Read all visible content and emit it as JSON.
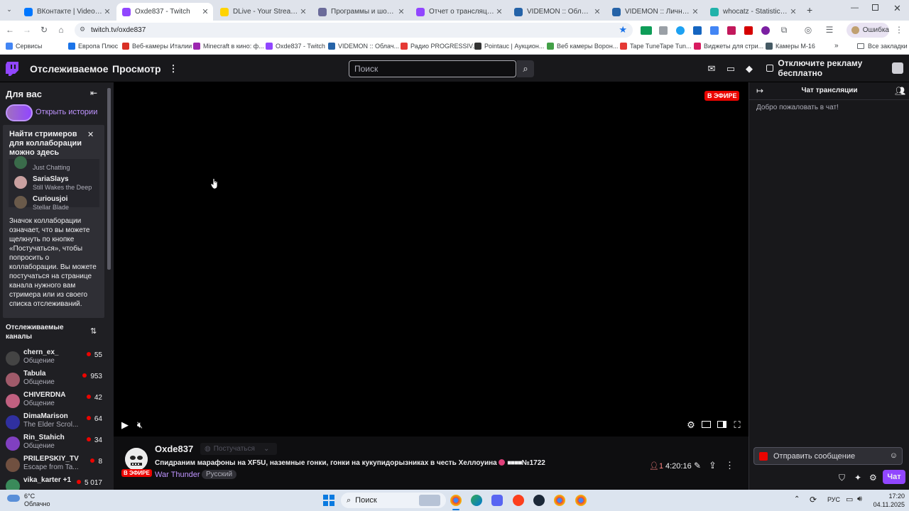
{
  "browser": {
    "tabs": [
      {
        "title": "ВКонтакте | Video Ext",
        "color": "#0077ff"
      },
      {
        "title": "Oxde837 - Twitch",
        "color": "#9146ff",
        "active": true
      },
      {
        "title": "DLive - Your Stream, Your",
        "color": "#ffd300"
      },
      {
        "title": "Программы и шоу | Евр",
        "color": "#6b6b9a"
      },
      {
        "title": "Отчет о трансляции - Tw",
        "color": "#9146ff"
      },
      {
        "title": "VIDEMON :: Облачное в",
        "color": "#2563a8"
      },
      {
        "title": "VIDEMON :: Личный каб",
        "color": "#2563a8"
      },
      {
        "title": "whocatz - Statistics - Twit",
        "color": "#20b2aa"
      }
    ],
    "url": "twitch.tv/oxde837",
    "error_label": "Ошибка",
    "bookmarks": [
      {
        "label": "Сервисы",
        "color": "#4285f4"
      },
      {
        "label": "Европа Плюс",
        "color": "#1a73e8"
      },
      {
        "label": "Веб-камеры Италии",
        "color": "#d93025"
      },
      {
        "label": "Minecraft в кино: ф...",
        "color": "#9c27b0"
      },
      {
        "label": "Oxde837 - Twitch",
        "color": "#9146ff"
      },
      {
        "label": "VIDEMON :: Облач...",
        "color": "#2563a8"
      },
      {
        "label": "Радио PROGRESSIV...",
        "color": "#e53935"
      },
      {
        "label": "Pointauc | Аукцион...",
        "color": "#333333"
      },
      {
        "label": "Веб камеры Ворон...",
        "color": "#43a047"
      },
      {
        "label": "Tape TuneTape Tun...",
        "color": "#e53935"
      },
      {
        "label": "Виджеты для стри...",
        "color": "#d81b60"
      },
      {
        "label": "Камеры М-16",
        "color": "#455a64"
      }
    ],
    "all_bookmarks_label": "Все закладки"
  },
  "twitch": {
    "nav": {
      "following": "Отслеживаемое",
      "browse": "Просмотр",
      "search_placeholder": "Поиск",
      "adfree": "Отключите рекламу бесплатно"
    },
    "sidebar": {
      "for_you": "Для вас",
      "open_stories": "Открыть истории",
      "popup_title": "Найти стримеров для коллаборации можно здесь",
      "popup_channels": [
        {
          "name": "",
          "game": "Just Chatting",
          "color": "#3a6b4a"
        },
        {
          "name": "SariaSlays",
          "game": "Still Wakes the Deep",
          "color": "#c9a0a0"
        },
        {
          "name": "Curiousjoi",
          "game": "Stellar Blade",
          "color": "#6a5a4a"
        }
      ],
      "popup_body": "Значок коллаборации означает, что вы можете щелкнуть по кнопке «Постучаться», чтобы попросить о коллаборации. Вы можете постучаться на странице канала нужного вам стримера или из своего списка отслеживаний.",
      "followed_title": "Отслеживаемые каналы",
      "followed": [
        {
          "name": "chern_ex_",
          "game": "Общение",
          "viewers": "55",
          "color": "#444444"
        },
        {
          "name": "Tabula",
          "game": "Общение",
          "viewers": "953",
          "color": "#a05a6a"
        },
        {
          "name": "CHIVERDNA",
          "game": "Общение",
          "viewers": "42",
          "color": "#c06080"
        },
        {
          "name": "DimaMarison",
          "game": "The Elder Scrol...",
          "viewers": "64",
          "color": "#3030a0"
        },
        {
          "name": "Rin_Stahich",
          "game": "Общение",
          "viewers": "34",
          "color": "#8040c0"
        },
        {
          "name": "PRILEPSKIY_TV",
          "game": "Escape from Ta...",
          "viewers": "8",
          "color": "#705040"
        },
        {
          "name": "vika_karter +1",
          "game": "",
          "viewers": "5 017",
          "color": "#3a8a5a"
        }
      ]
    },
    "player": {
      "live_badge": "В ЭФИРЕ"
    },
    "stream": {
      "channel": "Oxde837",
      "knock_label": "Постучаться",
      "title": "Спидраним марафоны на XF5U, наземные гонки, гонки на кукупидорызниках в честь Хеллоуина",
      "title_suffix": "№1722",
      "live_label": "В ЭФИРЕ",
      "category": "War Thunder",
      "tag": "Русский",
      "viewers": "1",
      "uptime": "4:20:16"
    },
    "chat": {
      "header": "Чат трансляции",
      "welcome": "Добро пожаловать в чат!",
      "input_placeholder": "Отправить сообщение",
      "send_label": "Чат"
    }
  },
  "taskbar": {
    "weather_temp": "6°C",
    "weather_desc": "Облачно",
    "search_label": "Поиск",
    "lang": "РУС",
    "time": "17:20",
    "date": "04.11.2025"
  }
}
